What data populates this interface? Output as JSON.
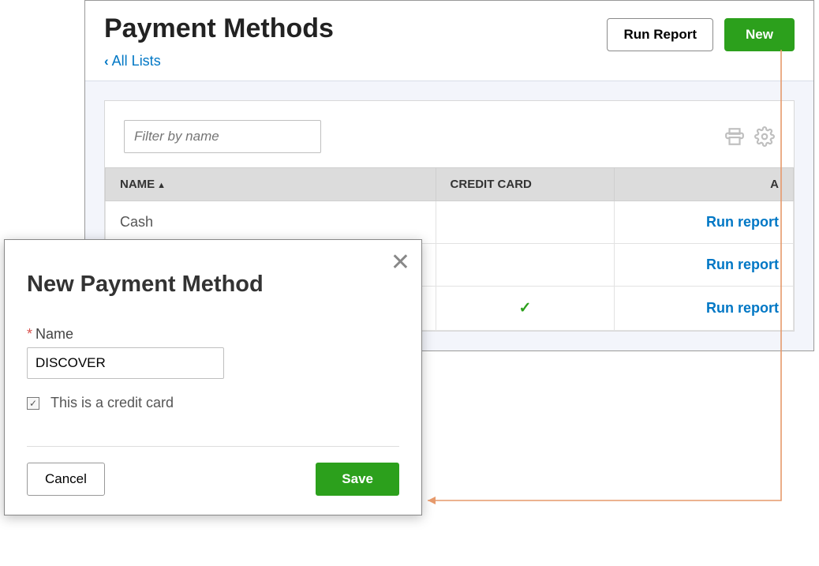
{
  "header": {
    "title": "Payment Methods",
    "run_report": "Run Report",
    "new": "New"
  },
  "breadcrumb": {
    "label": "All Lists"
  },
  "filter": {
    "placeholder": "Filter by name"
  },
  "table": {
    "col_name": "NAME",
    "col_credit_card": "CREDIT CARD",
    "col_action": "A",
    "rows": [
      {
        "name": "Cash",
        "is_cc": false,
        "action": "Run report"
      },
      {
        "name": "",
        "is_cc": false,
        "action": "Run report"
      },
      {
        "name": "",
        "is_cc": true,
        "action": "Run report"
      }
    ]
  },
  "modal": {
    "title": "New Payment Method",
    "name_label": "Name",
    "name_value": "DISCOVER",
    "cc_label": "This is a credit card",
    "cancel": "Cancel",
    "save": "Save"
  }
}
